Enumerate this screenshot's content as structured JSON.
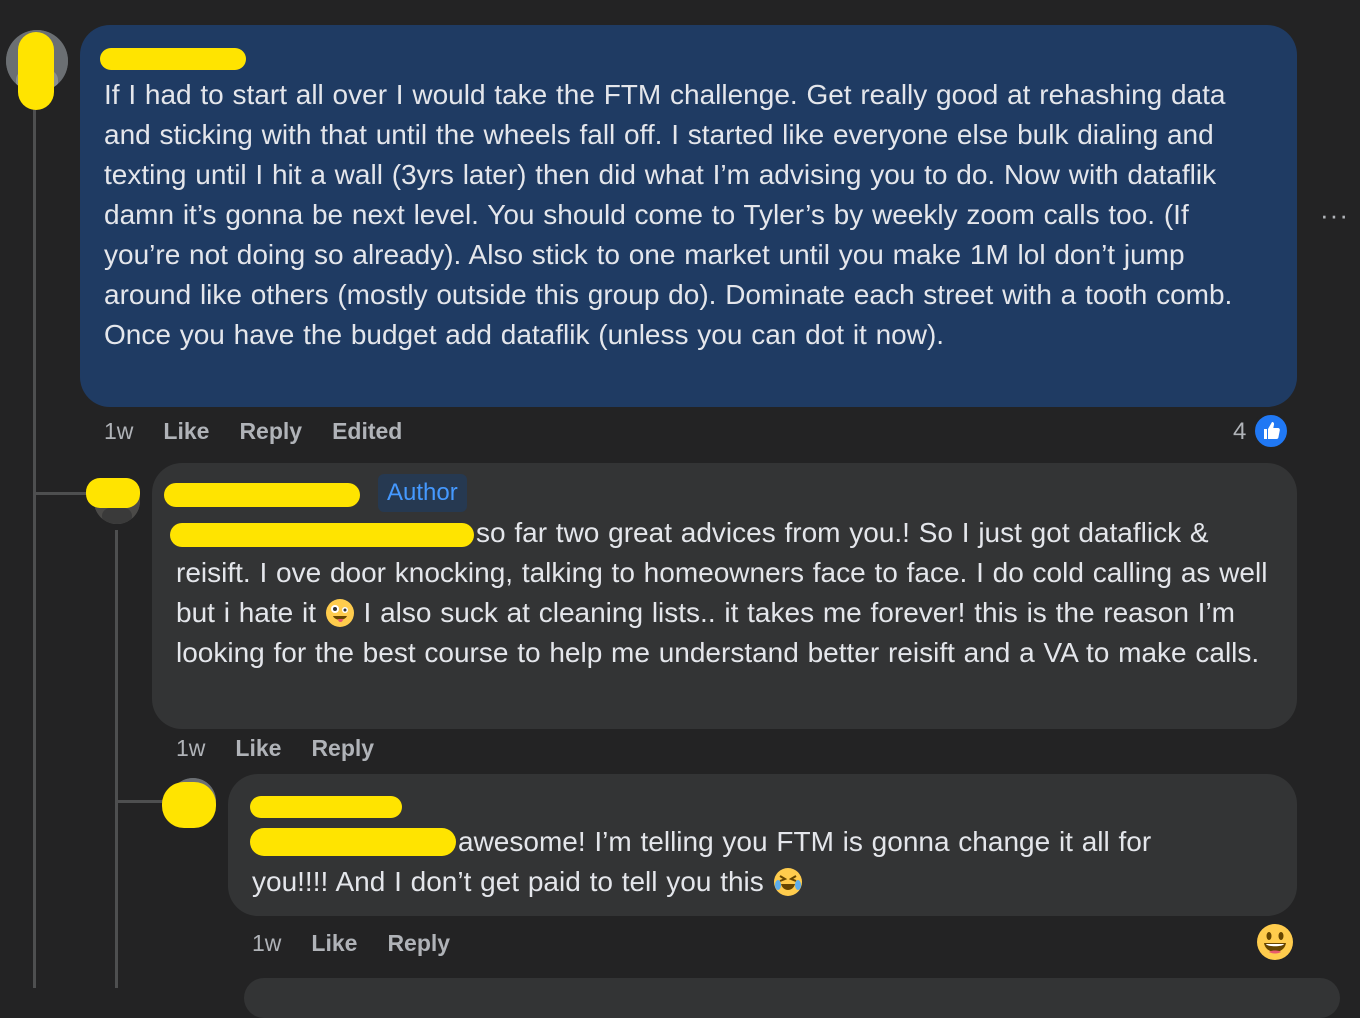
{
  "comments": [
    {
      "text": "If I had to start all over I would take the FTM challenge. Get really good at rehashing data and sticking with that until the wheels fall off. I started like everyone else bulk dialing and texting until I hit a wall (3yrs later) then did what I’m advising you to do. Now with dataflik damn it’s gonna be next level. You should come to Tyler’s by weekly zoom calls too. (If you’re not doing so already). Also stick to one market until you make 1M lol don’t jump around like others (mostly outside this group do). Dominate each street with a tooth comb. Once you have the budget add dataflik (unless you can dot it now).",
      "time": "1w",
      "like_label": "Like",
      "reply_label": "Reply",
      "edited_label": "Edited",
      "reaction_count": "4",
      "more_label": "···"
    },
    {
      "author_badge": "Author",
      "text_first": "so far two great advices from you.! So I just got dataflick &",
      "text_rest": "reisift. I ove door knocking, talking to homeowners face to face. I do cold calling as well but i hate it",
      "text_after_emoji": "I also suck at cleaning lists.. it takes me forever! this is the reason I’m looking for the best course to help me understand better reisift and a VA to make calls.",
      "time": "1w",
      "like_label": "Like",
      "reply_label": "Reply"
    },
    {
      "text_first": "awesome! I’m telling you FTM is gonna change it all for",
      "text_rest": "you!!!! And I don’t get paid to tell you this",
      "time": "1w",
      "like_label": "Like",
      "reply_label": "Reply"
    }
  ],
  "colors": {
    "background": "#232324",
    "highlight_bubble": "#1f3b63",
    "bubble": "#333435",
    "author_badge_text": "#4599ff",
    "like_blue": "#2078f4",
    "redaction": "#ffe400"
  },
  "icons": {
    "like_reaction": "thumbs-up-icon",
    "crazy_face": "zany-face-emoji",
    "laughing": "rolling-on-floor-laughing-emoji",
    "react_picker": "grinning-face-emoji"
  }
}
